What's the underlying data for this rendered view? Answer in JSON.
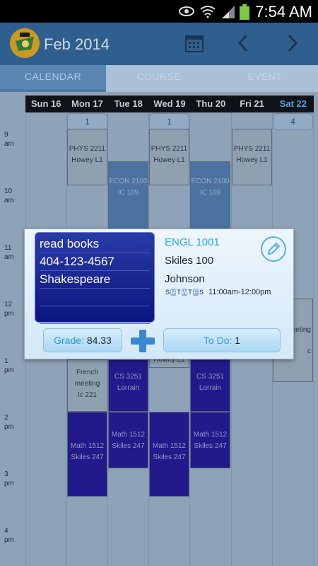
{
  "status_bar": {
    "time": "7:54 AM",
    "icons": [
      "eye-icon",
      "wifi-icon",
      "signal-icon",
      "battery-icon"
    ]
  },
  "app_bar": {
    "title": "Feb 2014",
    "icons": [
      "calendar-icon",
      "chevron-left-icon",
      "chevron-right-icon"
    ]
  },
  "tabs": [
    {
      "label": "CALENDAR",
      "active": true
    },
    {
      "label": "COURSE",
      "active": false
    },
    {
      "label": "EVENT",
      "active": false
    }
  ],
  "days": [
    "Sun 16",
    "Mon 17",
    "Tue 18",
    "Wed 19",
    "Thu 20",
    "Fri 21",
    "Sat 22"
  ],
  "hours": [
    {
      "h": "9",
      "ap": "am"
    },
    {
      "h": "10",
      "ap": "am"
    },
    {
      "h": "11",
      "ap": "am"
    },
    {
      "h": "12",
      "ap": "pm"
    },
    {
      "h": "1",
      "ap": "pm"
    },
    {
      "h": "2",
      "ap": "pm"
    },
    {
      "h": "3",
      "ap": "pm"
    },
    {
      "h": "4",
      "ap": "pm"
    }
  ],
  "badges": [
    "1",
    "1",
    "4"
  ],
  "events": [
    {
      "l1": "PHYS 2211",
      "l2": "Howey L1",
      "l3": ""
    },
    {
      "l1": "PHYS 2211",
      "l2": "Howey L1",
      "l3": ""
    },
    {
      "l1": "PHYS 2211",
      "l2": "Howey L1",
      "l3": ""
    },
    {
      "l1": "ECON 2100",
      "l2": "IC 109",
      "l3": ""
    },
    {
      "l1": "ECON 2100",
      "l2": "IC 109",
      "l3": ""
    },
    {
      "l1": "French",
      "l2": "meeting",
      "l3": "Ic 221"
    },
    {
      "l1": "CS 3251",
      "l2": "Lorrain",
      "l3": ""
    },
    {
      "l1": "CS 3251",
      "l2": "Lorrain",
      "l3": ""
    },
    {
      "l1": "Howey L1",
      "l2": "",
      "l3": ""
    },
    {
      "l1": "Math 1512",
      "l2": "Skiles 247",
      "l3": ""
    },
    {
      "l1": "Math 1512",
      "l2": "Skiles 247",
      "l3": ""
    },
    {
      "l1": "Math 1512",
      "l2": "Skiles 247",
      "l3": ""
    },
    {
      "l1": "Math 1512",
      "l2": "Skiles 247",
      "l3": ""
    },
    {
      "l1": "eeting",
      "l2": "",
      "l3": ""
    },
    {
      "l1": "c",
      "l2": "",
      "l3": ""
    }
  ],
  "dialog": {
    "notes": [
      "read books",
      "404-123-4567",
      "Shakespeare",
      "",
      ""
    ],
    "course_code": "ENGL 1001",
    "room": "Skiles 100",
    "professor": "Johnson",
    "weekdays": [
      "S",
      "M",
      "T",
      "W",
      "T",
      "F",
      "S"
    ],
    "weekdays_active": [
      false,
      true,
      false,
      true,
      false,
      true,
      false
    ],
    "time_range": "11:00am-12:00pm",
    "grade_label": "Grade:",
    "grade_value": "84.33",
    "todo_label": "To Do:",
    "todo_value": "1",
    "accent": "#2aa8e6"
  }
}
